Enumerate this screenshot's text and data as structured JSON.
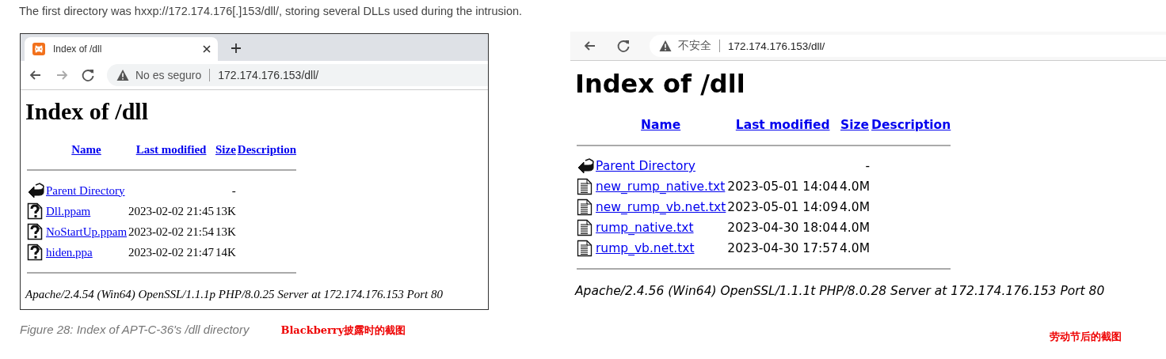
{
  "intro": "The first directory was hxxp://172.174.176[.]153/dll/, storing several DLLs used during the intrusion.",
  "left_shot": {
    "tab_title": "Index of /dll",
    "security": "No es seguro",
    "url": "172.174.176.153/dll/",
    "heading": "Index of /dll",
    "columns": [
      "Name",
      "Last modified",
      "Size",
      "Description"
    ],
    "rows": [
      {
        "kind": "parent",
        "name": "Parent Directory",
        "size": "-"
      },
      {
        "kind": "unknown",
        "name": "Dll.ppam",
        "modified": "2023-02-02 21:45",
        "size": "13K"
      },
      {
        "kind": "unknown",
        "name": "NoStartUp.ppam",
        "modified": "2023-02-02 21:54",
        "size": "13K"
      },
      {
        "kind": "unknown",
        "name": "hiden.ppa",
        "modified": "2023-02-02 21:47",
        "size": "14K"
      }
    ],
    "footer": "Apache/2.4.54 (Win64) OpenSSL/1.1.1p PHP/8.0.25 Server at 172.174.176.153 Port 80"
  },
  "caption": "Figure 28: Index of APT-C-36's /dll directory",
  "left_note": "Blackberry披露时的截图",
  "right_shot": {
    "security": "不安全",
    "url": "172.174.176.153/dll/",
    "heading": "Index of /dll",
    "columns": [
      "Name",
      "Last modified",
      "Size",
      "Description"
    ],
    "rows": [
      {
        "kind": "parent",
        "name": "Parent Directory",
        "size": "-"
      },
      {
        "kind": "text",
        "name": "new_rump_native.txt",
        "modified": "2023-05-01 14:04",
        "size": "4.0M"
      },
      {
        "kind": "text",
        "name": "new_rump_vb.net.txt",
        "modified": "2023-05-01 14:09",
        "size": "4.0M"
      },
      {
        "kind": "text",
        "name": "rump_native.txt",
        "modified": "2023-04-30 18:04",
        "size": "4.0M"
      },
      {
        "kind": "text",
        "name": "rump_vb.net.txt",
        "modified": "2023-04-30 17:57",
        "size": "4.0M"
      }
    ],
    "footer": "Apache/2.4.56 (Win64) OpenSSL/1.1.1t PHP/8.0.28 Server at 172.174.176.153 Port 80"
  },
  "right_note": "劳动节后的截图"
}
